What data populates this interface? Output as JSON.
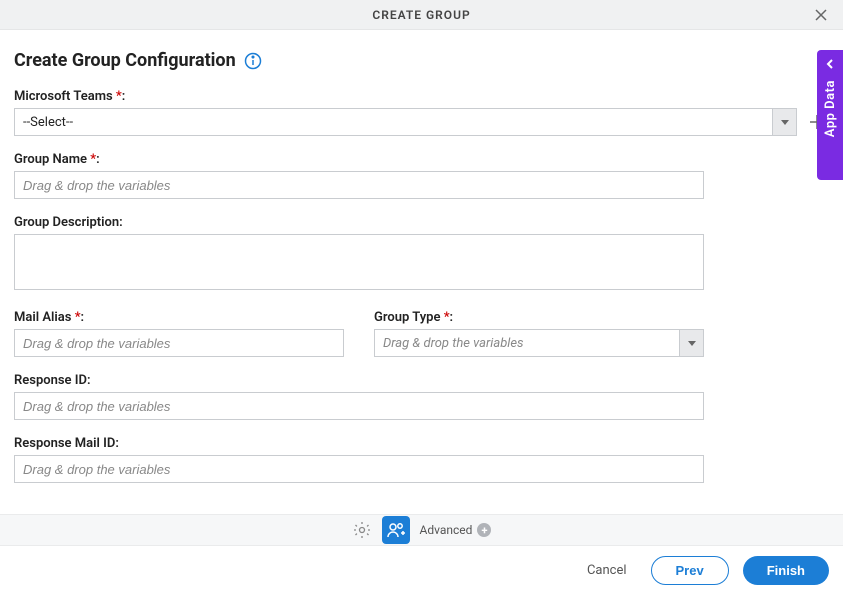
{
  "header": {
    "title": "CREATE GROUP"
  },
  "page": {
    "title": "Create Group Configuration"
  },
  "form": {
    "ms_teams": {
      "label": "Microsoft Teams",
      "selected": "--Select--"
    },
    "group_name": {
      "label": "Group Name",
      "placeholder": "Drag & drop the variables"
    },
    "group_desc": {
      "label": "Group Description:"
    },
    "mail_alias": {
      "label": "Mail Alias",
      "placeholder": "Drag & drop the variables"
    },
    "group_type": {
      "label": "Group Type",
      "placeholder": "Drag & drop the variables"
    },
    "response_id": {
      "label": "Response ID:",
      "placeholder": "Drag & drop the variables"
    },
    "response_mail": {
      "label": "Response Mail ID:",
      "placeholder": "Drag & drop the variables"
    }
  },
  "toolbar": {
    "advanced": "Advanced"
  },
  "footer": {
    "cancel": "Cancel",
    "prev": "Prev",
    "finish": "Finish"
  },
  "side": {
    "label": "App Data"
  }
}
